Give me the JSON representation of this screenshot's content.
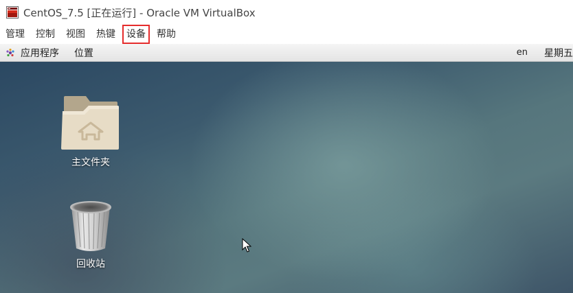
{
  "window": {
    "title": "CentOS_7.5 [正在运行] - Oracle VM VirtualBox",
    "icon": "virtualbox-app-icon"
  },
  "menubar": {
    "items": [
      "管理",
      "控制",
      "视图",
      "热键",
      "设备",
      "帮助"
    ],
    "highlighted_item": "设备",
    "highlight_color": "#e52b2b"
  },
  "gnome_panel": {
    "applications_label": "应用程序",
    "places_label": "位置",
    "language": "en",
    "day": "星期五"
  },
  "desktop": {
    "icons": [
      {
        "label": "主文件夹",
        "icon": "home-folder-icon"
      },
      {
        "label": "回收站",
        "icon": "trash-icon"
      }
    ]
  }
}
